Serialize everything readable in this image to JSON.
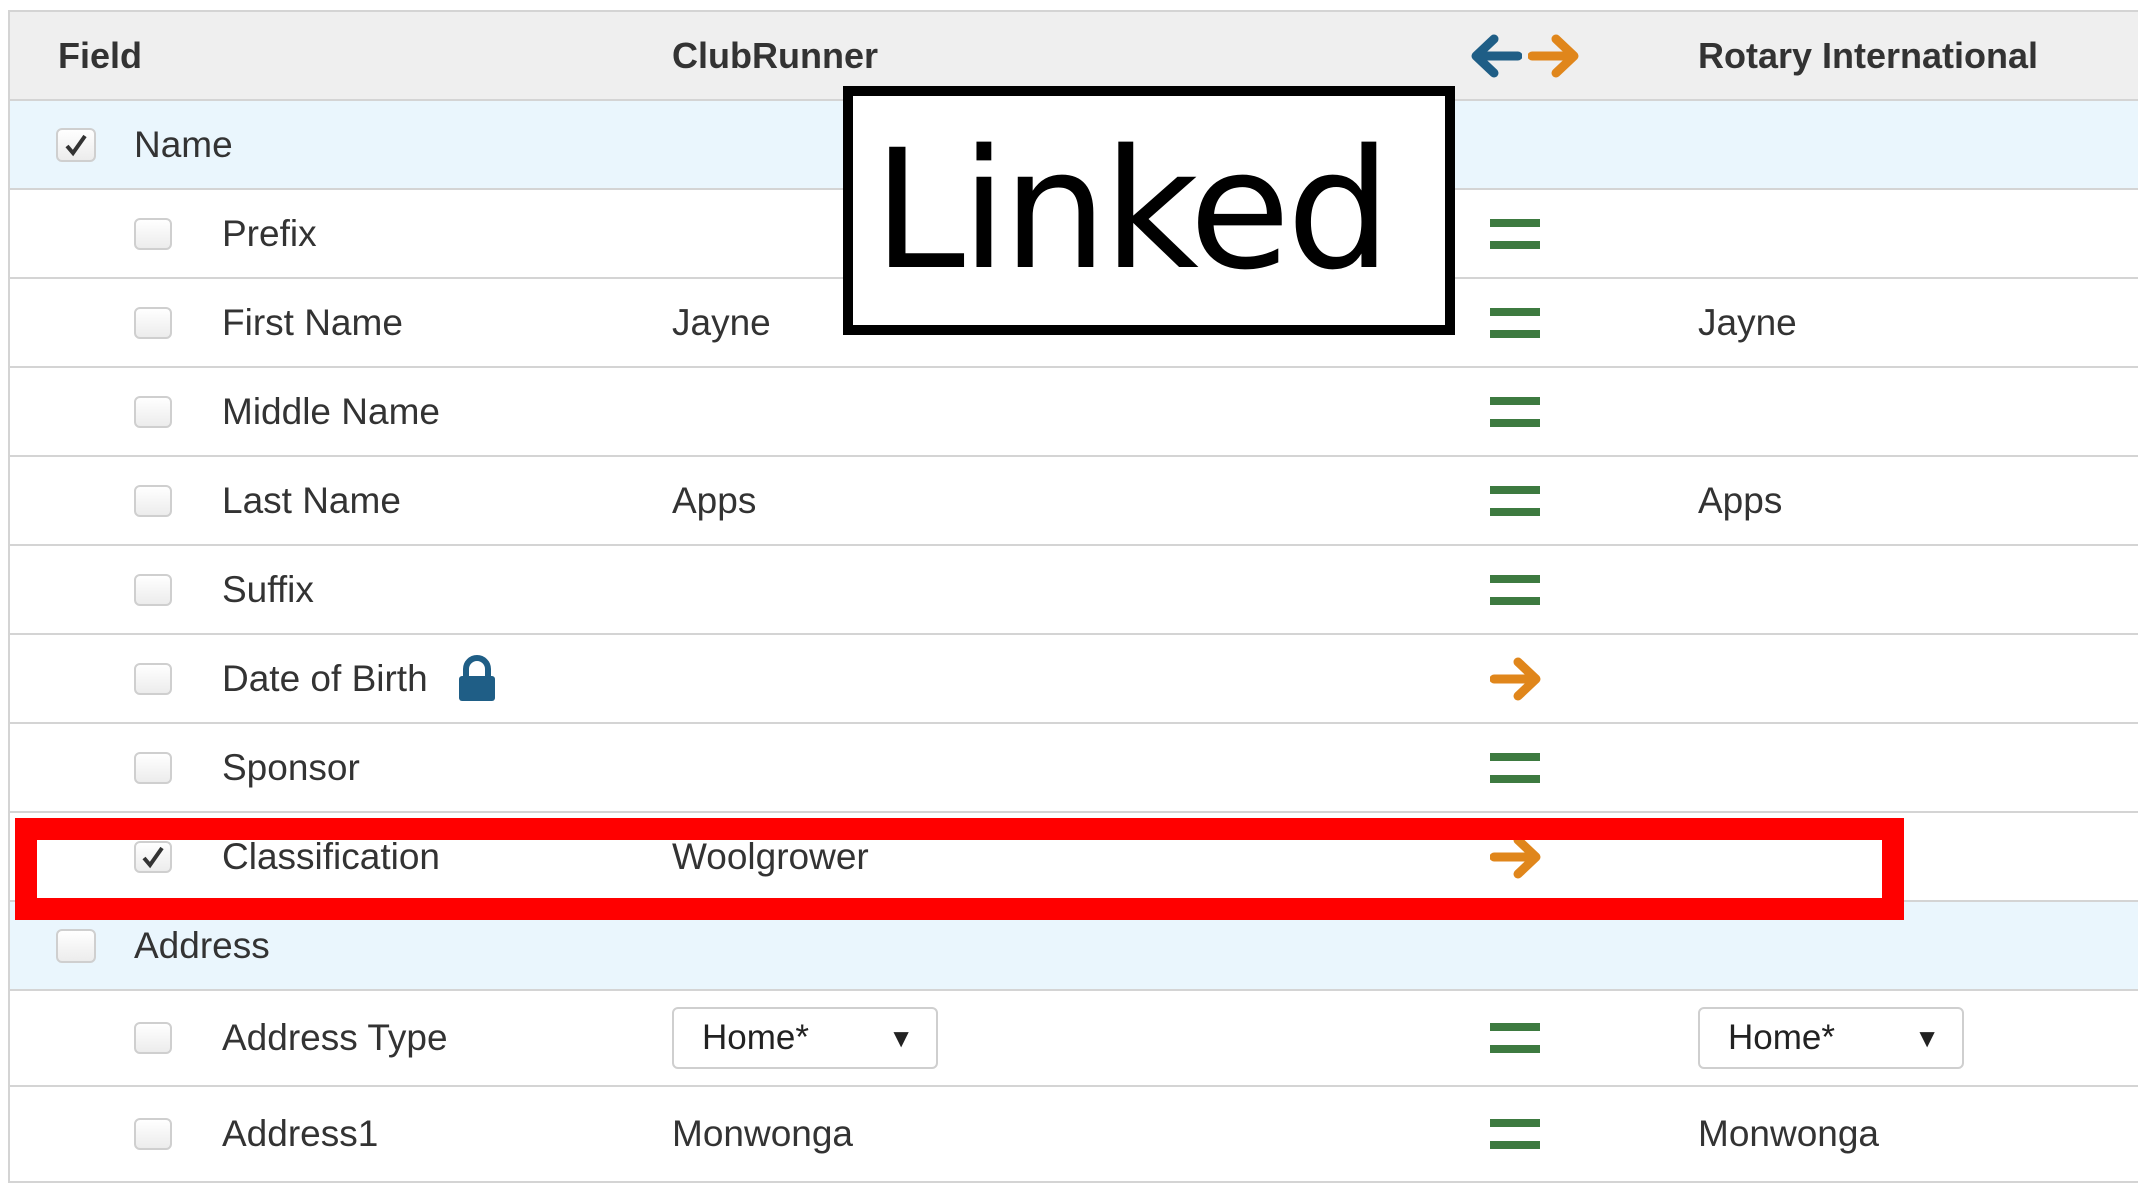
{
  "header": {
    "field": "Field",
    "clubrunner": "ClubRunner",
    "rotary": "Rotary International",
    "arrow_left_icon": "arrow-left-icon",
    "arrow_right_icon": "arrow-right-icon"
  },
  "overlay": {
    "linked_label": "Linked"
  },
  "colors": {
    "equal": "#3d7a40",
    "arrow_orange": "#e0861b",
    "arrow_blue": "#1f5e86",
    "highlight": "#ff0000",
    "section_bg": "#eaf6fd"
  },
  "rows": [
    {
      "type": "section",
      "label": "Name",
      "checked": true
    },
    {
      "type": "field",
      "label": "Prefix",
      "clubrunner": "",
      "status": "equal",
      "rotary": "",
      "checked": false
    },
    {
      "type": "field",
      "label": "First Name",
      "clubrunner": "Jayne",
      "status": "equal",
      "rotary": "Jayne",
      "checked": false
    },
    {
      "type": "field",
      "label": "Middle Name",
      "clubrunner": "",
      "status": "equal",
      "rotary": "",
      "checked": false
    },
    {
      "type": "field",
      "label": "Last Name",
      "clubrunner": "Apps",
      "status": "equal",
      "rotary": "Apps",
      "checked": false
    },
    {
      "type": "field",
      "label": "Suffix",
      "clubrunner": "",
      "status": "equal",
      "rotary": "",
      "checked": false
    },
    {
      "type": "field",
      "label": "Date of Birth",
      "locked": true,
      "clubrunner": "",
      "status": "arrow-right",
      "rotary": "",
      "checked": false
    },
    {
      "type": "field",
      "label": "Sponsor",
      "clubrunner": "",
      "status": "equal",
      "rotary": "",
      "checked": false
    },
    {
      "type": "field",
      "label": "Classification",
      "clubrunner": "Woolgrower",
      "status": "arrow-right",
      "rotary": "",
      "checked": true
    },
    {
      "type": "section",
      "label": "Address",
      "checked": false
    },
    {
      "type": "field",
      "label": "Address Type",
      "clubrunner_select": "Home*",
      "status": "equal",
      "rotary_select": "Home*",
      "checked": false
    },
    {
      "type": "field",
      "label": "Address1",
      "clubrunner": "Monwonga",
      "status": "equal",
      "rotary": "Monwonga",
      "checked": false
    }
  ]
}
